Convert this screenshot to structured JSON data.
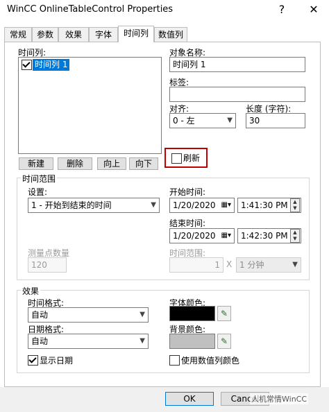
{
  "window": {
    "title": "WinCC OnlineTableControl Properties",
    "help": "?",
    "close": "✕"
  },
  "tabs": [
    "常规",
    "参数",
    "效果",
    "字体",
    "时间列",
    "数值列"
  ],
  "time_columns": {
    "label": "时间列:",
    "items": [
      {
        "label": "时间列 1",
        "checked": true
      }
    ],
    "buttons": {
      "new": "新建",
      "delete": "删除",
      "up": "向上",
      "down": "向下"
    }
  },
  "object_name": {
    "label": "对象名称:",
    "value": "时间列 1"
  },
  "tag": {
    "label": "标签:",
    "value": ""
  },
  "align": {
    "label": "对齐:",
    "value": "0 - 左"
  },
  "length": {
    "label": "长度 (字符):",
    "value": "30"
  },
  "refresh": {
    "label": "刷新",
    "checked": false,
    "highlight_color": "#c00000"
  },
  "time_range": {
    "group_label": "时间范围",
    "settings_label": "设置:",
    "settings_value": "1 - 开始到结束的时间",
    "start_label": "开始时间:",
    "start_date": "1/20/2020",
    "start_time": "1:41:30 PM",
    "end_label": "结束时间:",
    "end_date": "1/20/2020",
    "end_time": "1:42:30 PM",
    "measure_points_label": "测量点数量",
    "measure_points_value": "120",
    "range_label": "时间范围:",
    "range_factor": "1",
    "range_x": "X",
    "range_unit": "1 分钟"
  },
  "effects": {
    "group_label": "效果",
    "time_format_label": "时间格式:",
    "time_format_value": "自动",
    "date_format_label": "日期格式:",
    "date_format_value": "自动",
    "font_color_label": "字体颜色:",
    "font_color": "#000000",
    "bg_color_label": "背景颜色:",
    "bg_color": "#c0c0c0",
    "show_date_label": "显示日期",
    "show_date_checked": true,
    "use_value_color_label": "使用数值列颜色",
    "use_value_color_checked": false
  },
  "footer": {
    "ok": "OK",
    "cancel": "Cancel",
    "watermark": "人机常情WinCC"
  }
}
